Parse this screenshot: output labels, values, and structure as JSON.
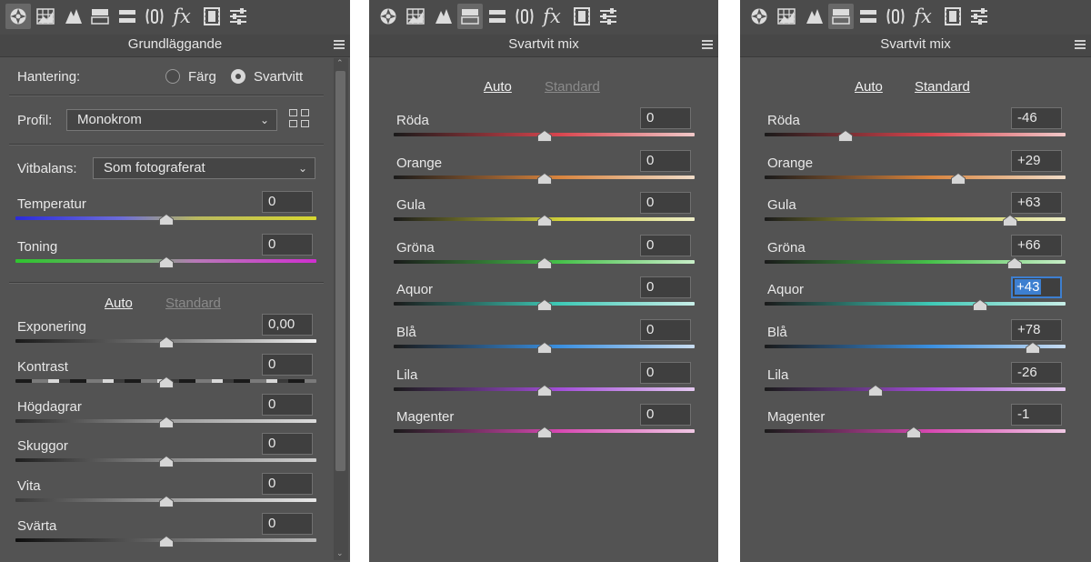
{
  "toolbar_icons": [
    "aperture-icon",
    "histogram-icon",
    "tone-curve-icon",
    "hsl-icon",
    "split-tone-icon",
    "lens-icon",
    "fx-icon",
    "camera-calibration-icon",
    "presets-icon"
  ],
  "fx_label": "fx",
  "panel1": {
    "title": "Grundläggande",
    "treatment": {
      "label": "Hantering:",
      "color_option": "Färg",
      "bw_option": "Svartvitt",
      "selected": "Svartvitt"
    },
    "profile": {
      "label": "Profil:",
      "value": "Monokrom"
    },
    "white_balance": {
      "label": "Vitbalans:",
      "value": "Som fotograferat"
    },
    "auto_label": "Auto",
    "standard_label": "Standard",
    "sliders": [
      {
        "label": "Temperatur",
        "value": "0",
        "level": 0.5
      },
      {
        "label": "Toning",
        "value": "0",
        "level": 0.5
      },
      {
        "label": "Exponering",
        "value": "0,00",
        "level": 0.5
      },
      {
        "label": "Kontrast",
        "value": "0",
        "level": 0.5
      },
      {
        "label": "Högdagrar",
        "value": "0",
        "level": 0.5
      },
      {
        "label": "Skuggor",
        "value": "0",
        "level": 0.5
      },
      {
        "label": "Vita",
        "value": "0",
        "level": 0.5
      },
      {
        "label": "Svärta",
        "value": "0",
        "level": 0.5
      }
    ]
  },
  "panel2": {
    "title": "Svartvit mix",
    "auto_label": "Auto",
    "standard_label": "Standard",
    "sliders": [
      {
        "label": "Röda",
        "value": "0",
        "level": 0.5
      },
      {
        "label": "Orange",
        "value": "0",
        "level": 0.5
      },
      {
        "label": "Gula",
        "value": "0",
        "level": 0.5
      },
      {
        "label": "Gröna",
        "value": "0",
        "level": 0.5
      },
      {
        "label": "Aquor",
        "value": "0",
        "level": 0.5
      },
      {
        "label": "Blå",
        "value": "0",
        "level": 0.5
      },
      {
        "label": "Lila",
        "value": "0",
        "level": 0.5
      },
      {
        "label": "Magenter",
        "value": "0",
        "level": 0.5
      }
    ]
  },
  "panel3": {
    "title": "Svartvit mix",
    "auto_label": "Auto",
    "standard_label": "Standard",
    "sliders": [
      {
        "label": "Röda",
        "value": "-46",
        "level": 0.27
      },
      {
        "label": "Orange",
        "value": "+29",
        "level": 0.645
      },
      {
        "label": "Gula",
        "value": "+63",
        "level": 0.815
      },
      {
        "label": "Gröna",
        "value": "+66",
        "level": 0.83
      },
      {
        "label": "Aquor",
        "value": "+43",
        "level": 0.715,
        "focused": true
      },
      {
        "label": "Blå",
        "value": "+78",
        "level": 0.89
      },
      {
        "label": "Lila",
        "value": "-26",
        "level": 0.37
      },
      {
        "label": "Magenter",
        "value": "-1",
        "level": 0.495
      }
    ]
  },
  "colors": {
    "panel_bg": "#535353",
    "focus": "#3d7fd0",
    "temperature": [
      "#2b2bd8",
      "#d8d830"
    ],
    "tint": [
      "#2fc42f",
      "#d02fd0"
    ],
    "red": "#d8454e",
    "orange": "#d8843e",
    "yellow": "#cfcf3a",
    "green": "#46c14a",
    "aqua": "#3ec9b6",
    "blue": "#3a8fe0",
    "purple": "#a24ed8",
    "magenta": "#d848b2"
  }
}
